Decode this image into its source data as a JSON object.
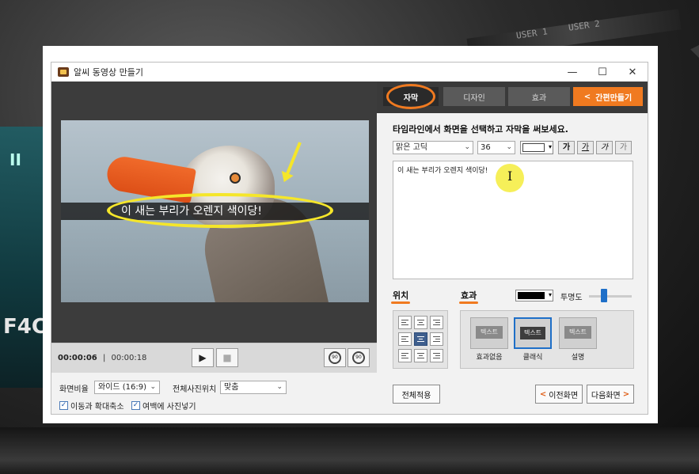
{
  "background": {
    "keyboard_labels": [
      "USER 1",
      "USER 2"
    ],
    "side_text": "F4C",
    "side_mark": "II"
  },
  "window": {
    "title": "알씨 동영상 만들기",
    "controls": {
      "minimize": "—",
      "maximize": "☐",
      "close": "✕"
    }
  },
  "preview": {
    "caption": "이 새는 부리가 오렌지 색이당!"
  },
  "playback": {
    "current_time": "00:00:06",
    "total_time": "00:00:18",
    "play_label": "▶",
    "stop_label": "■",
    "rotate_left_label": "90",
    "rotate_right_label": "90"
  },
  "options": {
    "aspect_label": "화면비율",
    "aspect_value": "와이드 (16:9)",
    "photo_position_label": "전체사진위치",
    "photo_position_value": "맞춤",
    "move_zoom_label": "이동과 확대축소",
    "margin_photo_label": "여백에 사진넣기"
  },
  "tabs": [
    {
      "label": "자막",
      "active": true
    },
    {
      "label": "디자인",
      "active": false
    },
    {
      "label": "효과",
      "active": false
    }
  ],
  "simple_button": {
    "icon": "<",
    "label": "간편만들기"
  },
  "subtitle": {
    "instruction": "타임라인에서 화면을 선택하고 자막을 써보세요.",
    "font": "맑은 고딕",
    "size": "36",
    "text_color": "#ffffff",
    "format_buttons": [
      "가",
      "가",
      "가",
      "가"
    ],
    "text": "이 새는 부리가 오렌지 색이당!"
  },
  "position_section": {
    "label": "위치"
  },
  "effect_section": {
    "label": "효과",
    "color": "#000000",
    "opacity_label": "투명도",
    "opacity_value": 0.35
  },
  "effects": [
    {
      "chip": "텍스트",
      "name": "효과없음",
      "selected": false
    },
    {
      "chip": "텍스트",
      "name": "클래식",
      "selected": true
    },
    {
      "chip": "텍스트",
      "name": "설명",
      "selected": false
    }
  ],
  "buttons": {
    "apply_all": "전체적용",
    "prev_icon": "<",
    "prev": "이전화면",
    "next": "다음화면",
    "next_icon": ">"
  },
  "colors": {
    "accent": "#f07a20",
    "highlight": "#f5e62a",
    "select_blue": "#1e6fc8"
  }
}
